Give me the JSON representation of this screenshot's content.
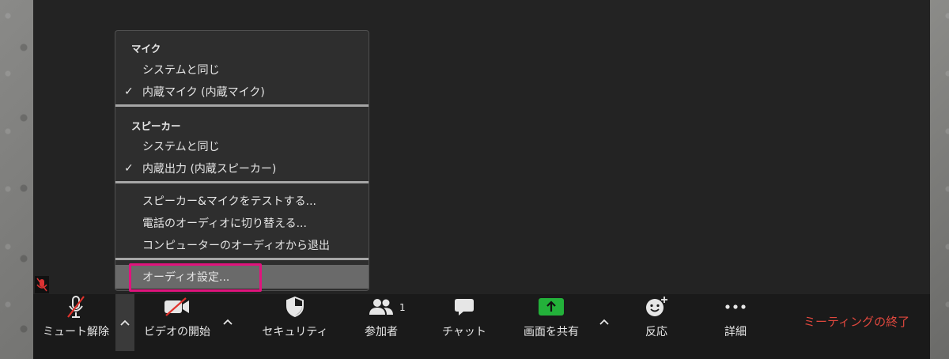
{
  "audio_menu": {
    "mic_section": "マイク",
    "mic_items": [
      {
        "label": "システムと同じ",
        "checked": false
      },
      {
        "label": "内蔵マイク (内蔵マイク)",
        "checked": true
      }
    ],
    "speaker_section": "スピーカー",
    "speaker_items": [
      {
        "label": "システムと同じ",
        "checked": false
      },
      {
        "label": "内蔵出力 (内蔵スピーカー)",
        "checked": true
      }
    ],
    "actions": [
      "スピーカー&マイクをテストする...",
      "電話のオーディオに切り替える...",
      "コンピューターのオーディオから退出"
    ],
    "settings_label": "オーディオ設定...",
    "check_glyph": "✓"
  },
  "toolbar": {
    "unmute": "ミュート解除",
    "start_video": "ビデオの開始",
    "security": "セキュリティ",
    "participants": "参加者",
    "participants_count": "1",
    "chat": "チャット",
    "share_screen": "画面を共有",
    "reactions": "反応",
    "more": "詳細",
    "end_meeting": "ミーティングの終了"
  },
  "colors": {
    "share_green": "#23b13a",
    "end_red": "#e0483e",
    "highlight_pink": "#e0137d",
    "muted_red": "#e0322c"
  }
}
